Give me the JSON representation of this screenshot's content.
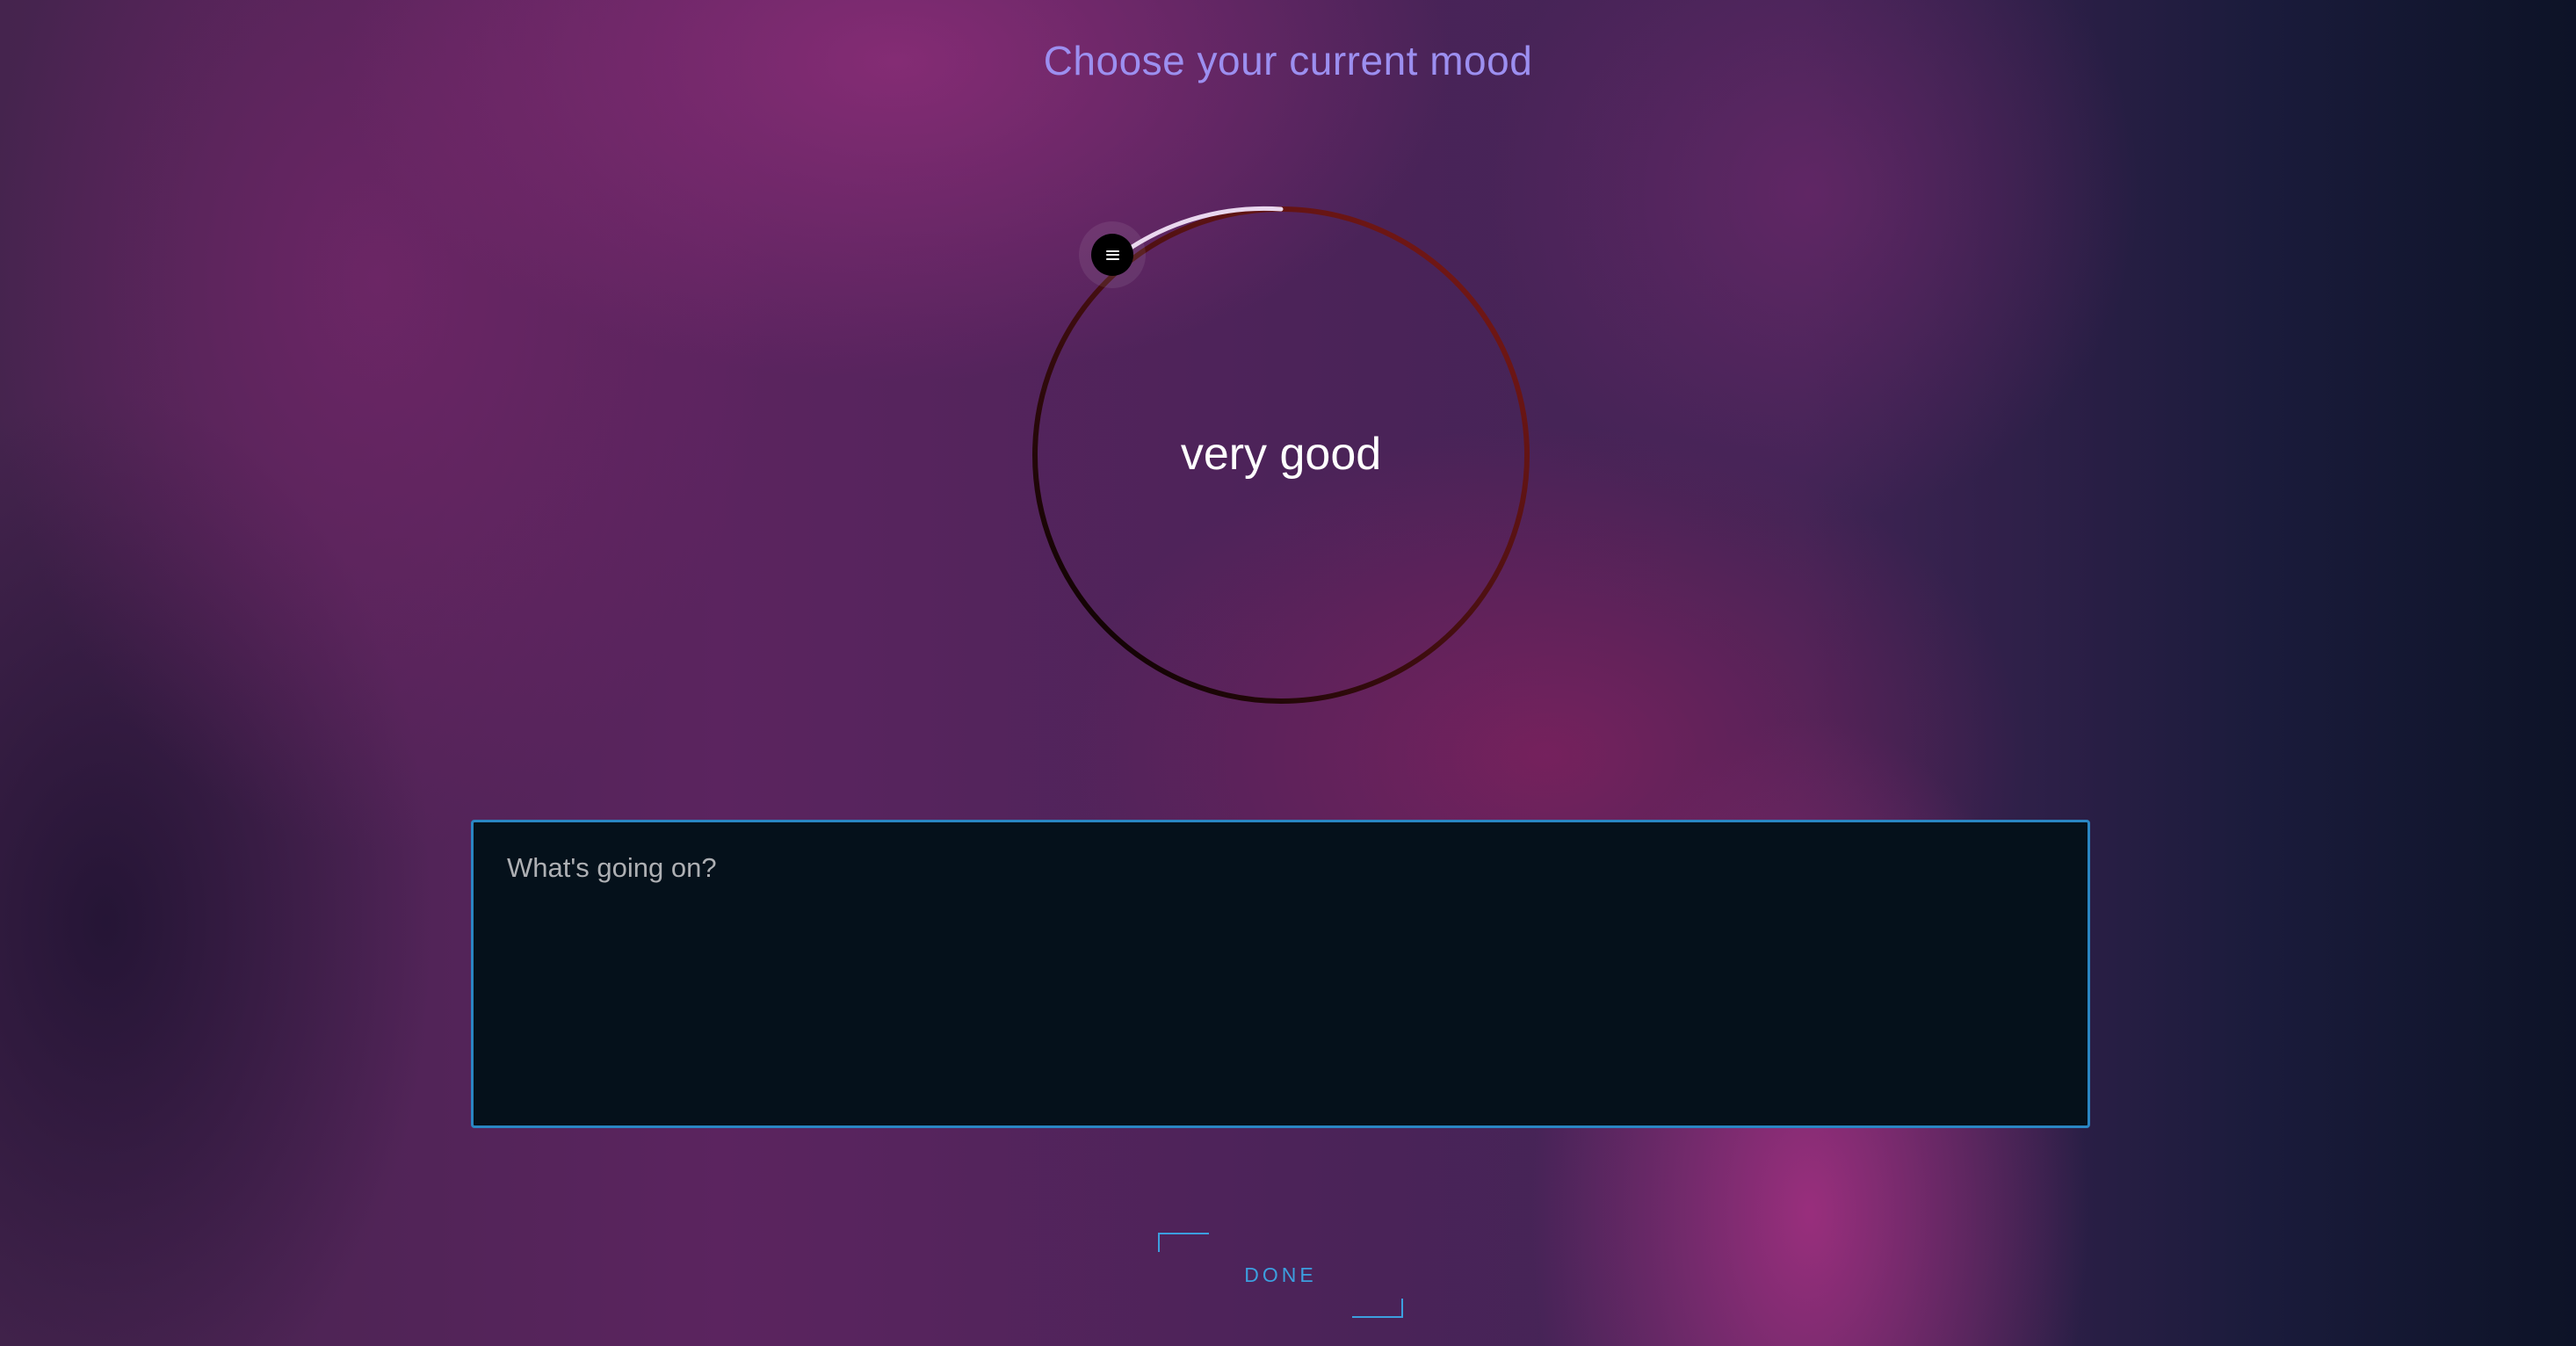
{
  "page": {
    "title": "Choose your current mood"
  },
  "mood_dial": {
    "current_mood": "very good",
    "handle_icon": "menu-lines-icon",
    "colors": {
      "selected_arc": "#e9d7ee",
      "track_start": "#000000",
      "track_end": "#7f1916",
      "handle": "#000000"
    }
  },
  "notes": {
    "placeholder": "What's going on?",
    "value": ""
  },
  "actions": {
    "done_label": "DONE",
    "accent_color": "#3c9fdf"
  }
}
